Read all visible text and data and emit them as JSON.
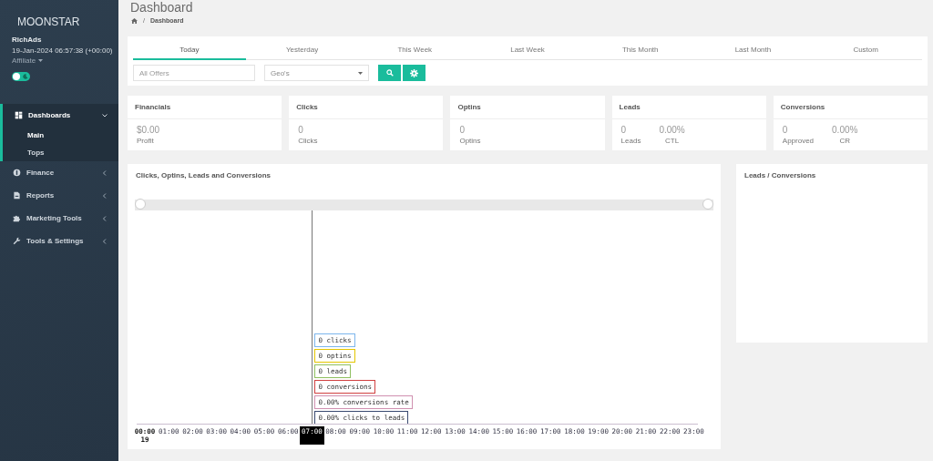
{
  "sidebar": {
    "brand": "MOONSTAR",
    "user": "RichAds",
    "datetime": "19-Jan-2024 06:57:38 (+00:00)",
    "role": "Affiliate",
    "theme_toggle": {
      "on": false
    },
    "items": [
      {
        "label": "Dashboards",
        "expanded": true,
        "children": [
          {
            "label": "Main",
            "selected": true
          },
          {
            "label": "Tops",
            "selected": false
          }
        ]
      },
      {
        "label": "Finance",
        "expanded": false
      },
      {
        "label": "Reports",
        "expanded": false
      },
      {
        "label": "Marketing Tools",
        "expanded": false
      },
      {
        "label": "Tools & Settings",
        "expanded": false
      }
    ]
  },
  "page": {
    "title": "Dashboard",
    "separator": "/",
    "breadcrumb": "Dashboard"
  },
  "tabs": [
    {
      "label": "Today",
      "selected": true
    },
    {
      "label": "Yesterday",
      "selected": false
    },
    {
      "label": "This Week",
      "selected": false
    },
    {
      "label": "Last Week",
      "selected": false
    },
    {
      "label": "This Month",
      "selected": false
    },
    {
      "label": "Last Month",
      "selected": false
    },
    {
      "label": "Custom",
      "selected": false
    }
  ],
  "filters": {
    "offers": {
      "placeholder": "All Offers"
    },
    "geo": {
      "value": "Geo's"
    }
  },
  "cards": [
    {
      "title": "Financials",
      "stats": [
        {
          "value": "$0.00",
          "label": "Profit"
        }
      ]
    },
    {
      "title": "Clicks",
      "stats": [
        {
          "value": "0",
          "label": "Clicks"
        }
      ]
    },
    {
      "title": "Optins",
      "stats": [
        {
          "value": "0",
          "label": "Optins"
        }
      ]
    },
    {
      "title": "Leads",
      "stats": [
        {
          "value": "0",
          "label": "Leads"
        },
        {
          "value": "0.00%",
          "label": "CTL"
        }
      ]
    },
    {
      "title": "Conversions",
      "stats": [
        {
          "value": "0",
          "label": "Approved"
        },
        {
          "value": "0.00%",
          "label": "CR"
        }
      ]
    }
  ],
  "chart": {
    "title": "Clicks, Optins, Leads and Conversions",
    "x_labels": [
      {
        "label": "00:00",
        "sub": "19",
        "hovered": false
      },
      {
        "label": "01:00",
        "hovered": false
      },
      {
        "label": "02:00",
        "hovered": false
      },
      {
        "label": "03:00",
        "hovered": false
      },
      {
        "label": "04:00",
        "hovered": false
      },
      {
        "label": "05:00",
        "hovered": false
      },
      {
        "label": "06:00",
        "hovered": false
      },
      {
        "label": "07:00",
        "hovered": true
      },
      {
        "label": "08:00",
        "hovered": false
      },
      {
        "label": "09:00",
        "hovered": false
      },
      {
        "label": "10:00",
        "hovered": false
      },
      {
        "label": "11:00",
        "hovered": false
      },
      {
        "label": "12:00",
        "hovered": false
      },
      {
        "label": "13:00",
        "hovered": false
      },
      {
        "label": "14:00",
        "hovered": false
      },
      {
        "label": "15:00",
        "hovered": false
      },
      {
        "label": "16:00",
        "hovered": false
      },
      {
        "label": "17:00",
        "hovered": false
      },
      {
        "label": "18:00",
        "hovered": false
      },
      {
        "label": "19:00",
        "hovered": false
      },
      {
        "label": "20:00",
        "hovered": false
      },
      {
        "label": "21:00",
        "hovered": false
      },
      {
        "label": "22:00",
        "hovered": false
      },
      {
        "label": "23:00",
        "hovered": false
      }
    ],
    "tooltips": [
      {
        "text": "0 clicks",
        "color": "#7cb5ec"
      },
      {
        "text": "0 optins",
        "color": "#e4c600"
      },
      {
        "text": "0 leads",
        "color": "#90c060"
      },
      {
        "text": "0 conversions",
        "color": "#d04040"
      },
      {
        "text": "0.00% conversions rate",
        "color": "#d090b0"
      },
      {
        "text": "0.00% clicks to leads",
        "color": "#3a4a70"
      }
    ]
  },
  "side_panel": {
    "title": "Leads / Conversions"
  }
}
